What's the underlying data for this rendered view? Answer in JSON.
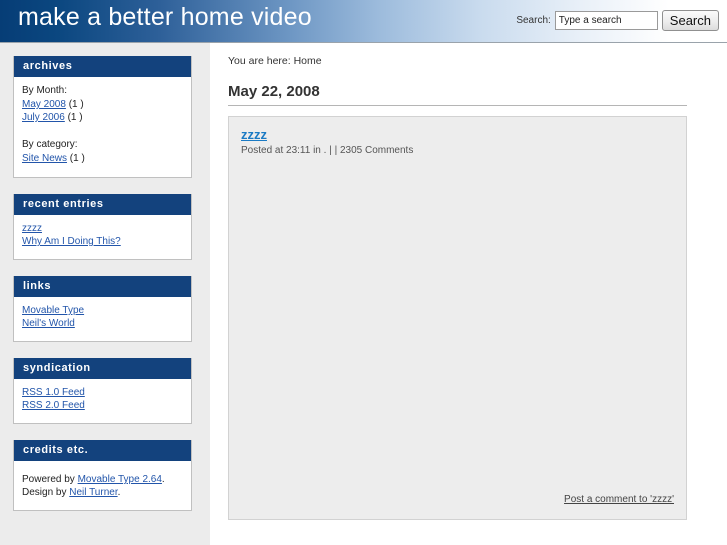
{
  "header": {
    "site_title": "make a better home video",
    "search": {
      "label": "Search:",
      "value": "Type a search",
      "placeholder": "Type a search",
      "button_label": "Search"
    }
  },
  "sidebar": {
    "modules": [
      {
        "id": "archives",
        "title": "archives",
        "by_month_label": "By Month:",
        "months": [
          {
            "label": "May 2008",
            "count": "(1 )"
          },
          {
            "label": "July 2006",
            "count": "(1 )"
          }
        ],
        "by_category_label": "By category:",
        "categories": [
          {
            "label": "Site News",
            "count": "(1 )"
          }
        ]
      },
      {
        "id": "recent",
        "title": "recent entries",
        "entries": [
          {
            "label": "zzzz"
          },
          {
            "label": "Why Am I Doing This?"
          }
        ]
      },
      {
        "id": "links",
        "title": "links",
        "entries": [
          {
            "label": "Movable Type"
          },
          {
            "label": "Neil's World"
          }
        ]
      },
      {
        "id": "syndication",
        "title": "syndication",
        "entries": [
          {
            "label": "RSS 1.0 Feed"
          },
          {
            "label": "RSS 2.0 Feed"
          }
        ]
      },
      {
        "id": "credits",
        "title": "credits etc.",
        "powered_by_prefix": "Powered by ",
        "powered_by_link": "Movable Type 2.64",
        "powered_by_suffix": ".",
        "design_by_prefix": "Design by ",
        "design_by_link": "Neil Turner",
        "design_by_suffix": "."
      }
    ]
  },
  "main": {
    "breadcrumb": "You are here: Home",
    "date_heading": "May 22, 2008",
    "post": {
      "title": "zzzz",
      "meta": "Posted at 23:11 in . | | 2305 Comments",
      "body": "",
      "comment_link": "Post a comment to 'zzzz'"
    }
  },
  "colors": {
    "header_start": "#063d76",
    "header_end": "#ffffff",
    "module_title_bg": "#13427d",
    "sidebar_bg": "#ececec",
    "link": "#2255aa",
    "post_title_link": "#1a7ac4",
    "post_box_bg": "#ededed"
  }
}
